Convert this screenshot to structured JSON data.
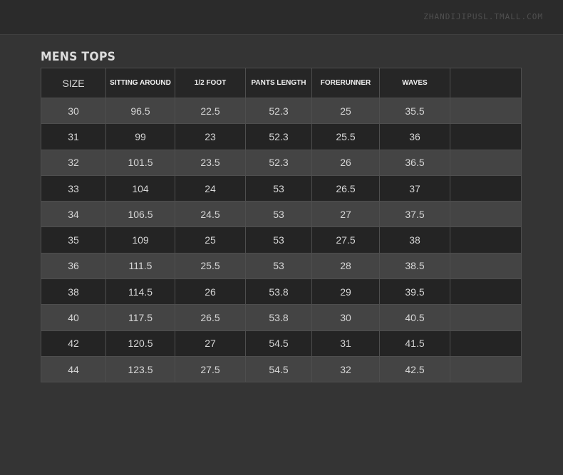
{
  "header": {
    "watermark": "ZHANDIJIPUSL.TMALL.COM"
  },
  "title": "MENS TOPS",
  "table": {
    "headers": [
      "SIZE",
      "SITTING AROUND",
      "1/2 FOOT",
      "PANTS LENGTH",
      "FORERUNNER",
      "WAVES",
      ""
    ],
    "rows": [
      [
        "30",
        "96.5",
        "22.5",
        "52.3",
        "25",
        "35.5",
        ""
      ],
      [
        "31",
        "99",
        "23",
        "52.3",
        "25.5",
        "36",
        ""
      ],
      [
        "32",
        "101.5",
        "23.5",
        "52.3",
        "26",
        "36.5",
        ""
      ],
      [
        "33",
        "104",
        "24",
        "53",
        "26.5",
        "37",
        ""
      ],
      [
        "34",
        "106.5",
        "24.5",
        "53",
        "27",
        "37.5",
        ""
      ],
      [
        "35",
        "109",
        "25",
        "53",
        "27.5",
        "38",
        ""
      ],
      [
        "36",
        "111.5",
        "25.5",
        "53",
        "28",
        "38.5",
        ""
      ],
      [
        "38",
        "114.5",
        "26",
        "53.8",
        "29",
        "39.5",
        ""
      ],
      [
        "40",
        "117.5",
        "26.5",
        "53.8",
        "30",
        "40.5",
        ""
      ],
      [
        "42",
        "120.5",
        "27",
        "54.5",
        "31",
        "41.5",
        ""
      ],
      [
        "44",
        "123.5",
        "27.5",
        "54.5",
        "32",
        "42.5",
        ""
      ]
    ]
  }
}
